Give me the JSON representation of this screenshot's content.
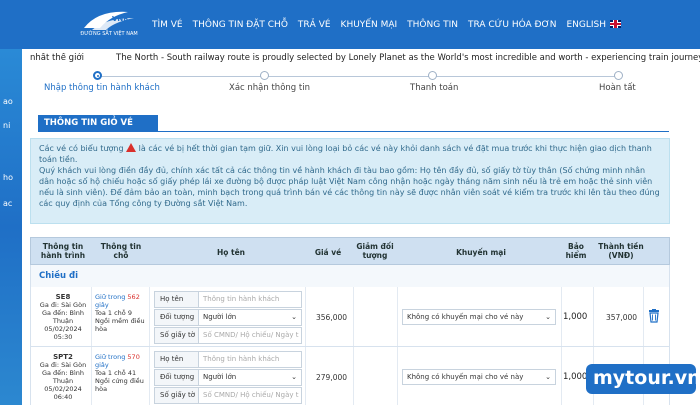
{
  "header": {
    "logo_text": "ĐƯỜNG SẮT VIỆT NAM",
    "nav": [
      "TÌM VÉ",
      "THÔNG TIN ĐẶT CHỖ",
      "TRẢ VÉ",
      "KHUYẾN MẠI",
      "THÔNG TIN",
      "TRA CỨU HÓA ĐƠN",
      "ENGLISH"
    ]
  },
  "left_strip": [
    "ao",
    "ni",
    "ho",
    "ac"
  ],
  "marquee": {
    "left": "nhất thế giới",
    "right": "The North - South railway route is proudly selected by Lonely Planet as the World's most incredible and worth - experiencing train journey"
  },
  "steps": [
    {
      "label": "Nhập thông tin hành khách",
      "active": true
    },
    {
      "label": "Xác nhận thông tin",
      "active": false
    },
    {
      "label": "Thanh toán",
      "active": false
    },
    {
      "label": "Hoàn tất",
      "active": false
    }
  ],
  "section_title": "THÔNG TIN GIỎ VÉ",
  "notice": {
    "p1_before": "Các vé có biểu tượng",
    "p1_after": "là các vé bị hết thời gian tạm giữ. Xin vui lòng loại bỏ các vé này khỏi danh sách vé đặt mua trước khi thực hiện giao dịch thanh toán tiền.",
    "p2": "Quý khách vui lòng điền đầy đủ, chính xác tất cả các thông tin về hành khách đi tàu bao gồm: Họ tên đầy đủ, số giấy tờ tùy thân (Số chứng minh nhân dân hoặc số hộ chiếu hoặc số giấy phép lái xe đường bộ được pháp luật Việt Nam công nhận hoặc ngày tháng năm sinh nếu là trẻ em hoặc thẻ sinh viên nếu là sinh viên). Để đảm bảo an toàn, minh bạch trong quá trình bán vé các thông tin này sẽ được nhân viên soát vé kiểm tra trước khi lên tàu theo đúng các quy định của Tổng công ty Đường sắt Việt Nam."
  },
  "table": {
    "headers": [
      "Thông tin hành trình",
      "Thông tin chỗ",
      "Họ tên",
      "Giá vé",
      "Giảm đối tượng",
      "Khuyến mại",
      "Bảo hiểm",
      "Thành tiền (VNĐ)"
    ],
    "direction": "Chiều đi",
    "field_labels": {
      "name": "Họ tên",
      "type": "Đối tượng",
      "doc": "Số giấy tờ"
    },
    "name_placeholder": "Thông tin hành khách",
    "doc_placeholder": "Số CMND/ Hộ chiếu/ Ngày t",
    "rows": [
      {
        "train": "SE8",
        "from": "Ga đi: Sài Gòn",
        "to": "Ga đến: Bình Thuận",
        "time": "05/02/2024 05:30",
        "hold_prefix": "Giữ trong",
        "hold_seconds": "562",
        "hold_suffix": "giây",
        "seat": "Toa 1 chỗ 9",
        "seat_class": "Ngồi mềm điều hòa",
        "type_value": "Người lớn",
        "price": "356,000",
        "promo": "Không có khuyến mại cho vé này",
        "insurance": "1,000",
        "total": "357,000"
      },
      {
        "train": "SPT2",
        "from": "Ga đi: Sài Gòn",
        "to": "Ga đến: Bình Thuận",
        "time": "05/02/2024 06:40",
        "hold_prefix": "Giữ trong",
        "hold_seconds": "570",
        "hold_suffix": "giây",
        "seat": "Toa 1 chỗ 41",
        "seat_class": "Ngồi cứng điều hòa",
        "type_value": "Người lớn",
        "price": "279,000",
        "promo": "Không có khuyến mại cho vé này",
        "insurance": "1,000",
        "total": ""
      }
    ]
  },
  "watermark": "mytour.vn"
}
